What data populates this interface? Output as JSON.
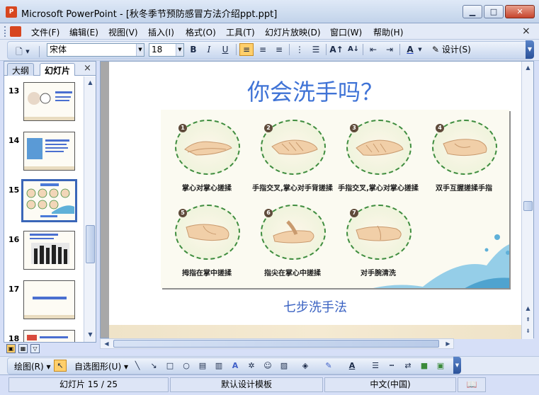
{
  "window": {
    "app_icon": "powerpoint-icon",
    "title": "Microsoft PowerPoint - [秋冬季节预防感冒方法介绍ppt.ppt]",
    "min_icon": "minimize-icon",
    "max_icon": "maximize-icon",
    "close_icon": "close-icon"
  },
  "menu": {
    "items": [
      "文件(F)",
      "编辑(E)",
      "视图(V)",
      "插入(I)",
      "格式(O)",
      "工具(T)",
      "幻灯片放映(D)",
      "窗口(W)",
      "帮助(H)"
    ],
    "close_glyph": "×"
  },
  "toolbar": {
    "font_name": "宋体",
    "font_size": "18",
    "bold": "B",
    "italic": "I",
    "underline": "U",
    "design_label": "设计(S)",
    "align_left_active": true
  },
  "left_pane": {
    "tabs": [
      "大纲",
      "幻灯片"
    ],
    "selected_tab": "幻灯片",
    "close_glyph": "×",
    "slides": [
      {
        "number": "13",
        "selected": false
      },
      {
        "number": "14",
        "selected": false
      },
      {
        "number": "15",
        "selected": true
      },
      {
        "number": "16",
        "selected": false
      },
      {
        "number": "17",
        "selected": false
      },
      {
        "number": "18",
        "selected": false
      }
    ]
  },
  "slide": {
    "title": "你会洗手吗？",
    "caption": "七步洗手法",
    "steps": [
      {
        "num": "1",
        "label": "掌心对掌心搓揉"
      },
      {
        "num": "2",
        "label": "手指交叉,掌心对手背搓揉"
      },
      {
        "num": "3",
        "label": "手指交叉,掌心对掌心搓揉"
      },
      {
        "num": "4",
        "label": "双手互握搓揉手指"
      },
      {
        "num": "5",
        "label": "拇指在掌中搓揉"
      },
      {
        "num": "6",
        "label": "指尖在掌心中搓揉"
      },
      {
        "num": "7",
        "label": "对手腕清洗"
      }
    ]
  },
  "drawing_toolbar": {
    "draw_label": "绘图(R)",
    "autoshape_label": "自选图形(U)"
  },
  "status": {
    "slide_position": "幻灯片 15 / 25",
    "template": "默认设计模板",
    "language": "中文(中国)"
  },
  "colors": {
    "title_blue": "#3f73d6",
    "caption_blue": "#3a62c2",
    "circle_green": "#3f8d3f",
    "selection_blue": "#3a66b8"
  }
}
